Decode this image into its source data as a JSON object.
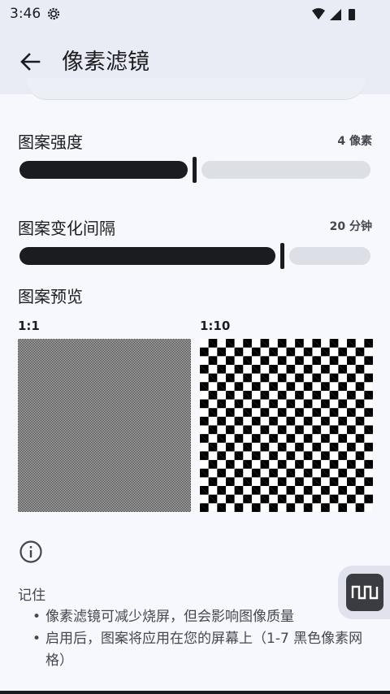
{
  "status_bar": {
    "time": "3:46"
  },
  "app_bar": {
    "title": "像素滤镜"
  },
  "pattern_intensity": {
    "label": "图案强度",
    "value_text": "4 像素",
    "level_fraction": 0.5
  },
  "pattern_interval": {
    "label": "图案变化间隔",
    "value_text": "20 分钟",
    "level_fraction": 0.75
  },
  "preview": {
    "label": "图案预览",
    "ratio_1": "1:1",
    "ratio_2": "1:10"
  },
  "notes": {
    "title": "记住",
    "items": [
      "像素滤镜可减少烧屏，但会影响图像质量",
      "启用后，图案将应用在您的屏幕上（1-7 黑色像素网格）"
    ]
  },
  "icons": {
    "status": [
      "gear-icon",
      "wifi-icon",
      "signal-icon",
      "battery-icon"
    ],
    "back": "arrow-left-icon",
    "info": "info-icon",
    "fab": "square-wave-icon"
  },
  "colors": {
    "dark": "#1b1c20",
    "track": "#dcdfe6",
    "background": "#f6f8fd",
    "header": "#e9ecf5"
  }
}
